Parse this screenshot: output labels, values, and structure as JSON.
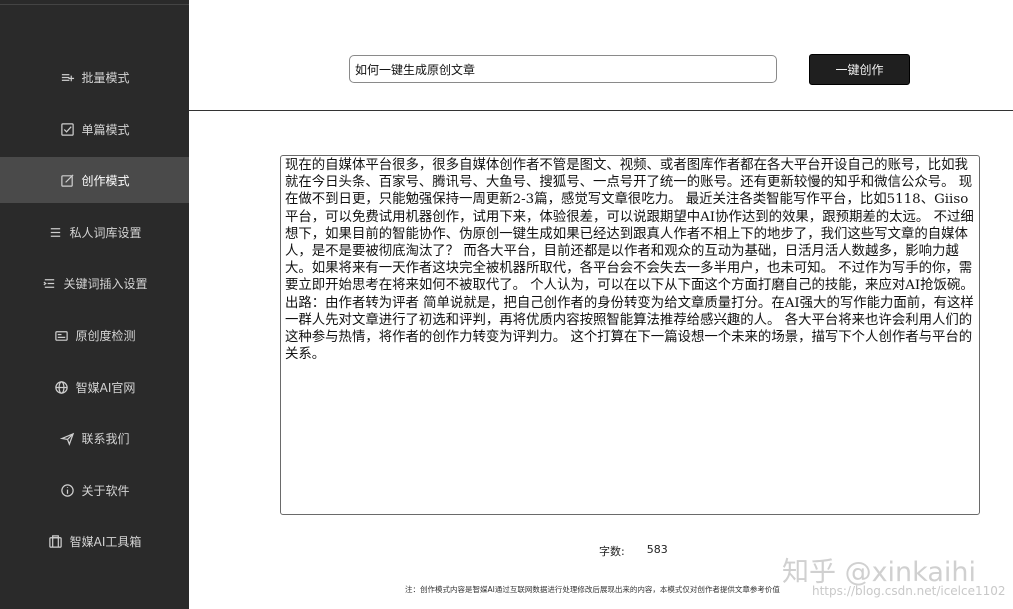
{
  "sidebar": {
    "items": [
      {
        "label": "批量模式",
        "icon": "batch-icon"
      },
      {
        "label": "单篇模式",
        "icon": "checkbox-icon"
      },
      {
        "label": "创作模式",
        "icon": "edit-icon"
      },
      {
        "label": "私人词库设置",
        "icon": "list-icon"
      },
      {
        "label": "关键词插入设置",
        "icon": "insert-icon"
      },
      {
        "label": "原创度检测",
        "icon": "scan-icon"
      },
      {
        "label": "智媒AI官网",
        "icon": "globe-icon"
      },
      {
        "label": "联系我们",
        "icon": "send-icon"
      },
      {
        "label": "关于软件",
        "icon": "info-icon"
      },
      {
        "label": "智媒AI工具箱",
        "icon": "toolbox-icon"
      }
    ],
    "active_index": 2
  },
  "header": {
    "title_input_value": "如何一键生成原创文章",
    "create_button_label": "一键创作"
  },
  "main": {
    "article_text": "现在的自媒体平台很多，很多自媒体创作者不管是图文、视频、或者图库作者都在各大平台开设自己的账号，比如我就在今日头条、百家号、腾讯号、大鱼号、搜狐号、一点号开了统一的账号。还有更新较慢的知乎和微信公众号。 现在做不到日更，只能勉强保持一周更新2-3篇，感觉写文章很吃力。 最近关注各类智能写作平台，比如5118、Giiso平台，可以免费试用机器创作，试用下来，体验很差，可以说跟期望中AI协作达到的效果，跟预期差的太远。 不过细想下，如果目前的智能协作、伪原创一键生成如果已经达到跟真人作者不相上下的地步了，我们这些写文章的自媒体人，是不是要被彻底淘汰了？ 而各大平台，目前还都是以作者和观众的互动为基础，日活月活人数越多，影响力越大。如果将来有一天作者这块完全被机器所取代，各平台会不会失去一多半用户，也未可知。 不过作为写手的你，需要立即开始思考在将来如何不被取代了。 个人认为，可以在以下从下面这个方面打磨自己的技能，来应对AI抢饭碗。 出路：由作者转为评者 简单说就是，把自己创作者的身份转变为给文章质量打分。在AI强大的写作能力面前，有这样一群人先对文章进行了初选和评判，再将优质内容按照智能算法推荐给感兴趣的人。 各大平台将来也许会利用人们的这种参与热情，将作者的创作力转变为评判力。 这个打算在下一篇设想一个未来的场景，描写下个人创作者与平台的关系。",
    "word_count_label": "字数:",
    "word_count_value": "583",
    "footer_note": "注：创作模式内容是智媒AI通过互联网数据进行处理修改后展现出来的内容，本模式仅对创作者提供文章参考价值"
  },
  "watermark": {
    "text": "知乎 @xinkaihi",
    "url": "https://blog.csdn.net/icelce1102"
  },
  "colors": {
    "sidebar_bg": "#2a2a2a",
    "sidebar_active_bg": "#4a4a4a",
    "button_bg": "#1f1f1f"
  }
}
